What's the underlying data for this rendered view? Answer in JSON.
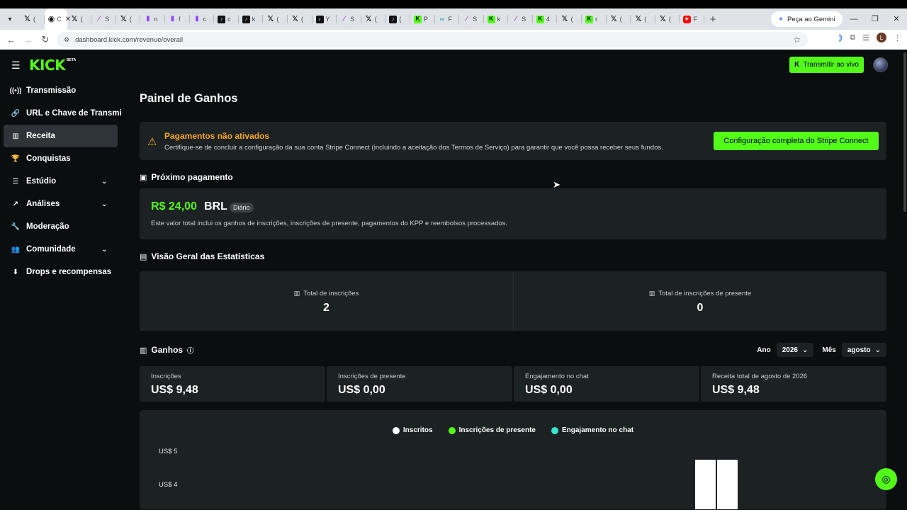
{
  "browser": {
    "tabs": [
      {
        "icon": "x-icon",
        "label": "("
      },
      {
        "icon": "active",
        "label": "C",
        "active": true
      },
      {
        "icon": "x-icon",
        "label": "("
      },
      {
        "icon": "sora-icon",
        "label": "S"
      },
      {
        "icon": "x-icon",
        "label": "("
      },
      {
        "icon": "twitch-icon",
        "label": "n"
      },
      {
        "icon": "twitch-icon",
        "label": "f"
      },
      {
        "icon": "twitch-icon",
        "label": "c"
      },
      {
        "icon": "tiktok-icon",
        "label": "c"
      },
      {
        "icon": "tiktok-icon",
        "label": "k"
      },
      {
        "icon": "x-icon",
        "label": "("
      },
      {
        "icon": "x-icon",
        "label": "("
      },
      {
        "icon": "tiktok-icon",
        "label": "Y"
      },
      {
        "icon": "sora-icon",
        "label": "S"
      },
      {
        "icon": "x-icon",
        "label": "("
      },
      {
        "icon": "tiktok-icon",
        "label": "("
      },
      {
        "icon": "kick-icon",
        "label": "P"
      },
      {
        "icon": "ai-icon",
        "label": "F"
      },
      {
        "icon": "sora-icon",
        "label": "S"
      },
      {
        "icon": "kick-icon",
        "label": "k"
      },
      {
        "icon": "sora-icon",
        "label": "S"
      },
      {
        "icon": "kick-icon",
        "label": "4"
      },
      {
        "icon": "x-icon",
        "label": "("
      },
      {
        "icon": "kick-icon",
        "label": "r"
      },
      {
        "icon": "x-icon",
        "label": "("
      },
      {
        "icon": "x-icon",
        "label": "("
      },
      {
        "icon": "x-icon",
        "label": "("
      },
      {
        "icon": "youtube-icon",
        "label": "F"
      }
    ],
    "new_tab": "+",
    "gemini_label": "Peça ao Gemini",
    "url": "dashboard.kick.com/revenue/overall",
    "profile_initial": "L"
  },
  "header": {
    "logo": "KICK",
    "logo_badge": "BETA",
    "live_button": "Transmitir ao vivo"
  },
  "sidebar": {
    "items": [
      {
        "label": "Transmissão",
        "icon": "broadcast-icon",
        "glyph": "((•))"
      },
      {
        "label": "URL e Chave de Transmissão",
        "icon": "link-icon",
        "glyph": "🔗"
      },
      {
        "label": "Receita",
        "icon": "chart-icon",
        "glyph": "▥",
        "active": true
      },
      {
        "label": "Conquistas",
        "icon": "trophy-icon",
        "glyph": "🏆"
      },
      {
        "label": "Estúdio",
        "icon": "studio-icon",
        "glyph": "☰",
        "expandable": true
      },
      {
        "label": "Análises",
        "icon": "analytics-icon",
        "glyph": "↗",
        "expandable": true
      },
      {
        "label": "Moderação",
        "icon": "wrench-icon",
        "glyph": "🔧"
      },
      {
        "label": "Comunidade",
        "icon": "community-icon",
        "glyph": "👥",
        "expandable": true
      },
      {
        "label": "Drops e recompensas",
        "icon": "drops-icon",
        "glyph": "⬇"
      }
    ]
  },
  "main": {
    "title": "Painel de Ganhos",
    "warning": {
      "title": "Pagamentos não ativados",
      "text": "Certifique-se de concluir a configuração da sua conta Stripe Connect (incluindo a aceitação dos Termos de Serviço) para garantir que você possa receber seus fundos.",
      "button": "Configuração completa do Stripe Connect"
    },
    "next_payout": {
      "section_title": "Próximo pagamento",
      "amount": "R$ 24,00",
      "currency": "BRL",
      "frequency": "Diário",
      "description": "Este valor total inclui os ganhos de inscrições, inscrições de presente, pagamentos do KPP e reembolsos processados."
    },
    "stats": {
      "section_title": "Visão Geral das Estatísticas",
      "total_subs_label": "Total de inscrições",
      "total_subs_value": "2",
      "total_gift_label": "Total de inscrições de presente",
      "total_gift_value": "0"
    },
    "earnings": {
      "section_title": "Ganhos",
      "year_label": "Ano",
      "year_value": "2026",
      "month_label": "Mês",
      "month_value": "agosto",
      "cards": [
        {
          "label": "Inscrições",
          "value": "US$ 9,48"
        },
        {
          "label": "Inscrições de presente",
          "value": "US$ 0,00"
        },
        {
          "label": "Engajamento no chat",
          "value": "US$ 0,00"
        },
        {
          "label": "Receita total de agosto de 2026",
          "value": "US$ 9,48"
        }
      ]
    }
  },
  "chart_data": {
    "type": "bar",
    "series": [
      {
        "name": "Inscritos",
        "color": "#ffffff",
        "values": [
          9.48
        ]
      },
      {
        "name": "Inscrições de presente",
        "color": "#53fc18",
        "values": [
          0
        ]
      },
      {
        "name": "Engajamento no chat",
        "color": "#36e8d0",
        "values": [
          0
        ]
      }
    ],
    "y_ticks": [
      "US$ 5",
      "US$ 4"
    ],
    "visible_bars": 2
  },
  "colors": {
    "accent": "#53fc18",
    "warning": "#f5a623",
    "card_bg": "#1c2124",
    "page_bg": "#0b0e0f"
  }
}
